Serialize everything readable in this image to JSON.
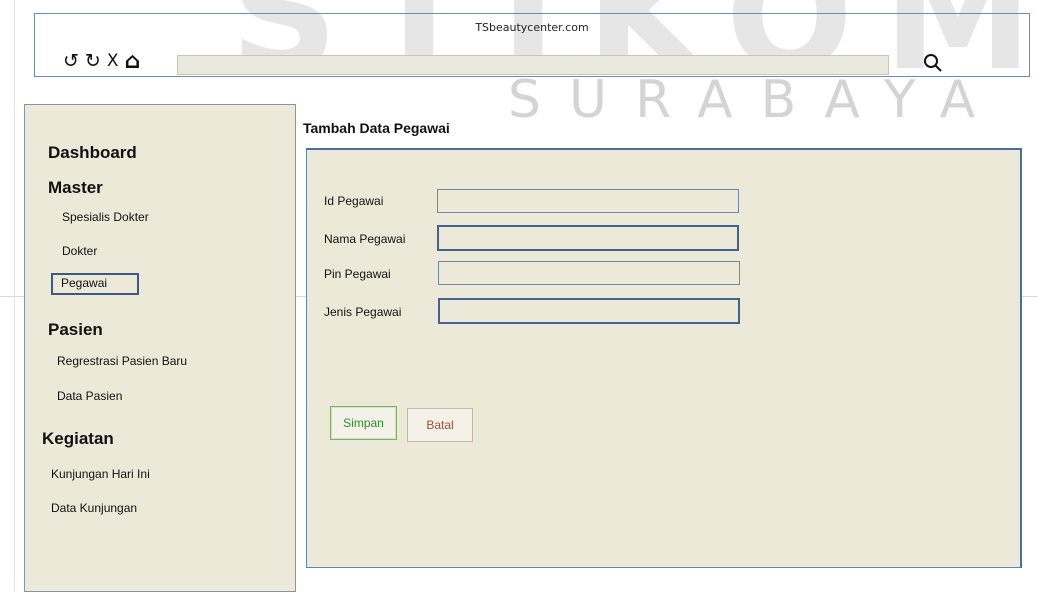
{
  "watermark": {
    "text": "STIKOM",
    "subtext": "SURABAYA"
  },
  "browser": {
    "title": "TSbeautycenter.com",
    "address_value": "",
    "nav_icons": [
      {
        "name": "back-icon",
        "glyph": "↺"
      },
      {
        "name": "refresh-icon",
        "glyph": "↻"
      },
      {
        "name": "stop-icon",
        "glyph": "X"
      },
      {
        "name": "home-icon",
        "glyph": "⌂"
      }
    ]
  },
  "sidebar": {
    "dashboard": "Dashboard",
    "master": {
      "heading": "Master",
      "items": [
        "Spesialis Dokter",
        "Dokter",
        "Pegawai"
      ]
    },
    "pasien": {
      "heading": "Pasien",
      "items": [
        "Regrestrasi Pasien Baru",
        "Data Pasien"
      ]
    },
    "kegiatan": {
      "heading": "Kegiatan",
      "items": [
        "Kunjungan Hari Ini",
        "Data Kunjungan"
      ]
    }
  },
  "main": {
    "title": "Tambah Data Pegawai",
    "fields": [
      {
        "label": "Id Pegawai",
        "value": ""
      },
      {
        "label": "Nama Pegawai",
        "value": ""
      },
      {
        "label": "Pin Pegawai",
        "value": ""
      },
      {
        "label": "Jenis Pegawai",
        "value": ""
      }
    ],
    "save_label": "Simpan",
    "cancel_label": "Batal"
  },
  "colors": {
    "panel_bg": "#ece9d8",
    "border_blue": "#4a6f9c",
    "save_text": "#2e8b2e",
    "cancel_text": "#a0522d"
  }
}
